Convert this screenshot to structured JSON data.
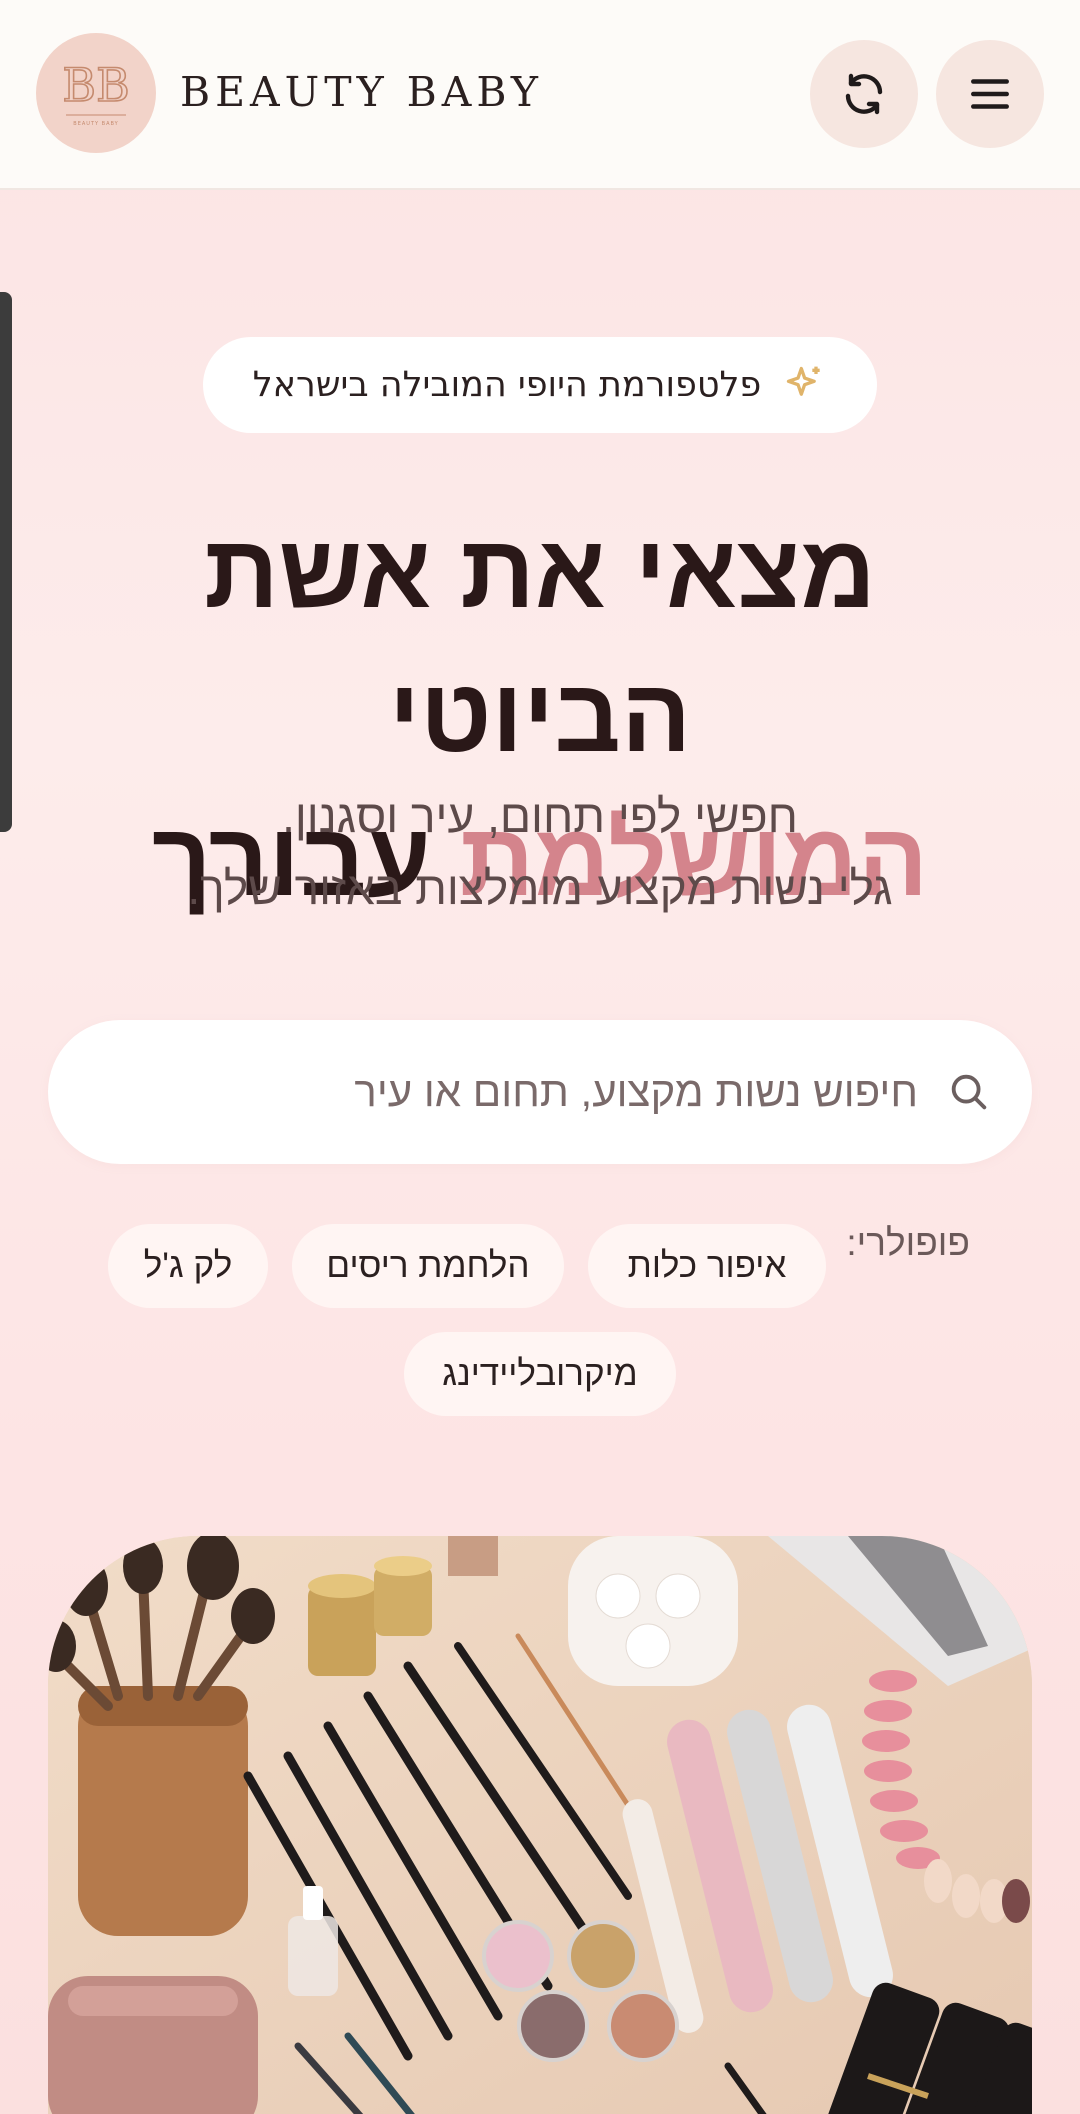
{
  "header": {
    "brand": "BEAUTY BABY",
    "logo_monogram": "BB",
    "logo_tagline": "BEAUTY BABY"
  },
  "hero": {
    "badge_text": "פלטפורמת היופי המובילה בישראל",
    "headline_line1": "מצאי את אשת הביוטי",
    "headline_accent": "המושלמת",
    "headline_rest": "עבורך",
    "subtitle_line1": "חפשי לפי תחום, עיר וסגנון.",
    "subtitle_line2": "גלי נשות מקצוע מומלצות באזור שלך."
  },
  "search": {
    "placeholder": "חיפוש נשות מקצוע, תחום או עיר"
  },
  "popular": {
    "label": "פופולרי:",
    "chips": [
      "איפור כלות",
      "הלחמת ריסים",
      "לק ג'ל",
      "מיקרובליידינג"
    ]
  },
  "colors": {
    "accent": "#d4848c",
    "header_bg": "#fdfbf8",
    "button_bg": "#f6e6e0",
    "sparkle": "#e0b46a"
  },
  "icons": {
    "refresh": "refresh-icon",
    "menu": "hamburger-menu-icon",
    "sparkle": "sparkle-icon",
    "search": "search-icon"
  }
}
